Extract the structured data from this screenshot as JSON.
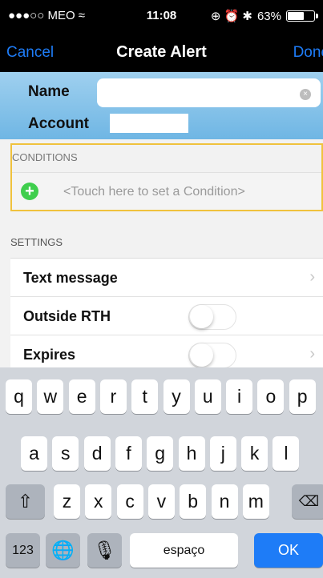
{
  "status_bar": {
    "carrier": "●●●○○ MEO ≈",
    "time": "11:08",
    "icons": "⊕ ⏰ ✱",
    "battery_percent": "63%",
    "battery_level": 0.63
  },
  "nav": {
    "cancel": "Cancel",
    "title": "Create Alert",
    "done": "Done"
  },
  "header": {
    "name_label": "Name",
    "name_value": "",
    "account_label": "Account",
    "account_value": ""
  },
  "conditions": {
    "title": "CONDITIONS",
    "placeholder": "<Touch here to set a Condition>"
  },
  "settings": {
    "title": "SETTINGS",
    "text_message": "Text message",
    "outside_rth": "Outside RTH",
    "expires": "Expires"
  },
  "keyboard": {
    "row1": [
      "q",
      "w",
      "e",
      "r",
      "t",
      "y",
      "u",
      "i",
      "o",
      "p"
    ],
    "row2": [
      "a",
      "s",
      "d",
      "f",
      "g",
      "h",
      "j",
      "k",
      "l"
    ],
    "row3": [
      "z",
      "x",
      "c",
      "v",
      "b",
      "n",
      "m"
    ],
    "numbers": "123",
    "space": "espaço",
    "ok": "OK"
  },
  "colors": {
    "accent": "#1e7cf7",
    "header": "#7fbfe8",
    "highlight": "#f0c23d",
    "add": "#3fce4d"
  }
}
